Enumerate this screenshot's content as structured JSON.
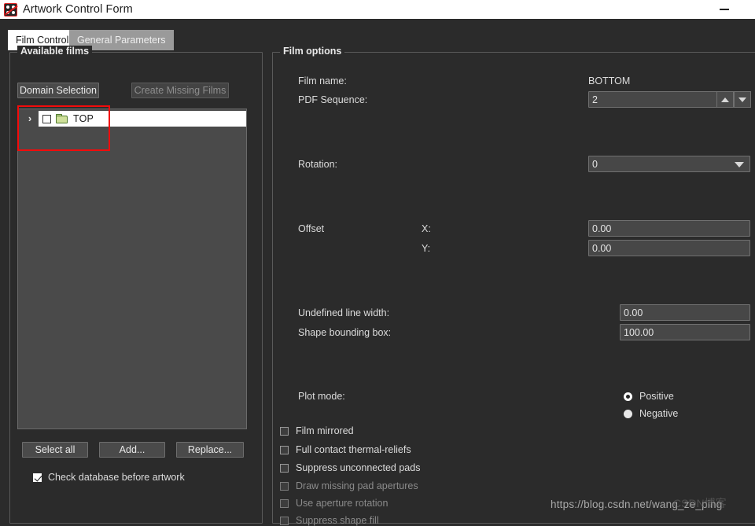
{
  "window": {
    "title": "Artwork Control Form",
    "app_icon": "dice-artwork-icon",
    "minimize_label": "—"
  },
  "tabs": [
    {
      "label": "Film Control",
      "active": true
    },
    {
      "label": "General Parameters",
      "active": false
    }
  ],
  "available_films": {
    "legend": "Available films",
    "domain_selection_button": "Domain Selection",
    "create_missing_films_button": "Create Missing Films",
    "tree": {
      "expander": "›",
      "items": [
        {
          "label": "TOP",
          "checked": false,
          "icon": "folder-icon"
        }
      ]
    },
    "buttons": {
      "select_all": "Select all",
      "add": "Add...",
      "replace": "Replace..."
    },
    "check_database": {
      "label": "Check database before artwork",
      "checked": true
    }
  },
  "film_options": {
    "legend": "Film options",
    "film_name_label": "Film name:",
    "film_name_value": "BOTTOM",
    "pdf_sequence_label": "PDF Sequence:",
    "pdf_sequence_value": "2",
    "rotation_label": "Rotation:",
    "rotation_value": "0",
    "offset_label": "Offset",
    "offset_x_label": "X:",
    "offset_x_value": "0.00",
    "offset_y_label": "Y:",
    "offset_y_value": "0.00",
    "undefined_line_width_label": "Undefined line width:",
    "undefined_line_width_value": "0.00",
    "shape_bounding_box_label": "Shape bounding box:",
    "shape_bounding_box_value": "100.00",
    "plot_mode_label": "Plot mode:",
    "plot_mode_options": [
      {
        "label": "Positive",
        "style": "ring"
      },
      {
        "label": "Negative",
        "style": "solid"
      }
    ],
    "checkboxes": [
      {
        "label": "Film mirrored",
        "checked": false,
        "enabled": true
      },
      {
        "label": "Full contact thermal-reliefs",
        "checked": false,
        "enabled": true
      },
      {
        "label": "Suppress unconnected pads",
        "checked": false,
        "enabled": true
      },
      {
        "label": "Draw missing pad apertures",
        "checked": false,
        "enabled": false
      },
      {
        "label": "Use aperture rotation",
        "checked": false,
        "enabled": false
      },
      {
        "label": "Suppress shape fill",
        "checked": false,
        "enabled": false
      }
    ]
  },
  "watermark": {
    "url": "https://blog.csdn.net/wang_ze_ping",
    "logo": "CSDN博客"
  },
  "colors": {
    "window_background": "#2b2b2b",
    "titlebar_background": "#ffffff",
    "field_background": "#474747",
    "highlight_red": "#f30b0b",
    "folder_green": "#cfe09a",
    "active_tab": "#ffffff",
    "inactive_tab": "#9a9a9a"
  }
}
